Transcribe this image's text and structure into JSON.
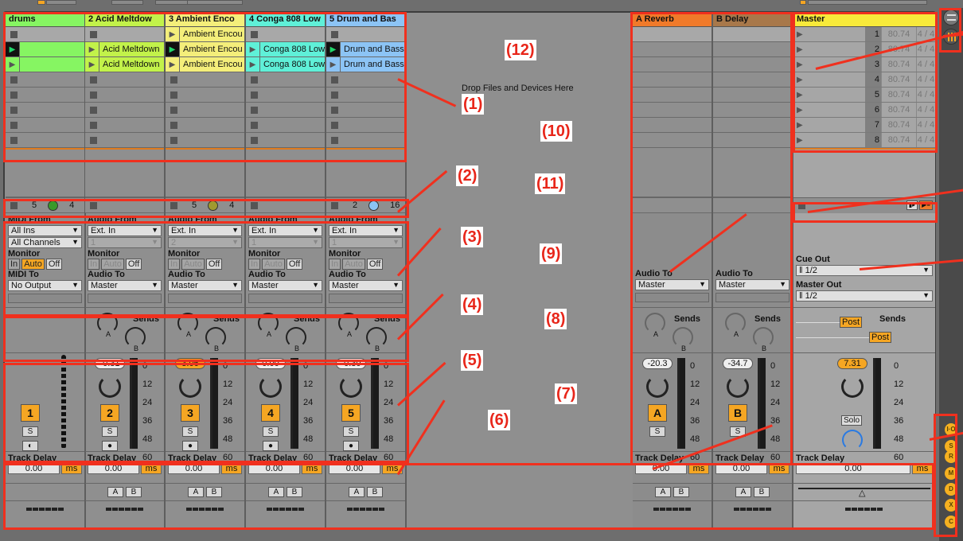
{
  "drop_hint": "Drop Files and Devices Here",
  "tracks": [
    {
      "name": "drums",
      "color": "#86f562",
      "clips": [
        null,
        {
          "name": "",
          "active": true
        },
        {
          "name": "",
          "active": false
        },
        null,
        null,
        null,
        null,
        null
      ],
      "first_slot_stop": true,
      "status": {
        "a": "5",
        "b": "4",
        "dot_color": "#3a9a2a"
      },
      "io": {
        "from_label": "MIDI From",
        "from": "All Ins",
        "channel": "All Channels",
        "channel_disabled": false,
        "to_label": "MIDI To",
        "to": "No Output",
        "monitor_state": "Auto"
      },
      "has_sends": false,
      "number": "1",
      "volume": null,
      "delay": "0.00",
      "has_ab": false
    },
    {
      "name": "2 Acid Meltdow",
      "color": "#c2f24a",
      "clips": [
        null,
        {
          "name": "Acid Meltdown",
          "active": false
        },
        {
          "name": "Acid Meltdown",
          "active": false
        },
        null,
        null,
        null,
        null,
        null
      ],
      "status": null,
      "io": {
        "from_label": "Audio From",
        "from": "Ext. In",
        "channel": "1",
        "channel_disabled": true,
        "to_label": "Audio To",
        "to": "Master",
        "monitor_state": "Off"
      },
      "has_sends": true,
      "number": "2",
      "volume": "-0.31",
      "volume_highlight": false,
      "delay": "0.00",
      "has_ab": true
    },
    {
      "name": "3 Ambient Enco",
      "color": "#f4ee7a",
      "clips": [
        {
          "name": "Ambient Encou",
          "active": false
        },
        {
          "name": "Ambient Encou",
          "active": true
        },
        {
          "name": "Ambient Encou",
          "active": false
        },
        null,
        null,
        null,
        null,
        null
      ],
      "status": {
        "a": "5",
        "b": "4",
        "dot_color": "#a09a30"
      },
      "io": {
        "from_label": "Audio From",
        "from": "Ext. In",
        "channel": "2",
        "channel_disabled": true,
        "to_label": "Audio To",
        "to": "Master",
        "monitor_state": "Off"
      },
      "has_sends": true,
      "number": "3",
      "volume": "3.06",
      "volume_highlight": true,
      "delay": "0.00",
      "has_ab": true
    },
    {
      "name": "4 Conga 808 Low",
      "color": "#5ff0d8",
      "clips": [
        null,
        {
          "name": "Conga 808 Low",
          "active": false
        },
        {
          "name": "Conga 808 Low",
          "active": false
        },
        null,
        null,
        null,
        null,
        null
      ],
      "status": null,
      "io": {
        "from_label": "Audio From",
        "from": "Ext. In",
        "channel": "1",
        "channel_disabled": true,
        "to_label": "Audio To",
        "to": "Master",
        "monitor_state": "Off"
      },
      "has_sends": true,
      "number": "4",
      "volume": "0.00",
      "volume_highlight": false,
      "delay": "0.00",
      "has_ab": true
    },
    {
      "name": "5 Drum and Bas",
      "color": "#8cc4f5",
      "clips": [
        null,
        {
          "name": "Drum and Bass",
          "active": true
        },
        {
          "name": "Drum and Bass",
          "active": false
        },
        null,
        null,
        null,
        null,
        null
      ],
      "status": {
        "a": "2",
        "b": "16",
        "dot_color": "#8cc4f5"
      },
      "io": {
        "from_label": "Audio From",
        "from": "Ext. In",
        "channel": "1",
        "channel_disabled": true,
        "to_label": "Audio To",
        "to": "Master",
        "monitor_state": "Off"
      },
      "has_sends": true,
      "number": "5",
      "volume": "-0.30",
      "volume_highlight": false,
      "delay": "0.00",
      "has_ab": true
    }
  ],
  "returns": [
    {
      "name": "A Reverb",
      "color": "#f07a2a",
      "audio_to_label": "Audio To",
      "audio_to": "Master",
      "volume": "-20.3",
      "letter": "A",
      "delay": "0.00"
    },
    {
      "name": "B Delay",
      "color": "#a8784a",
      "audio_to_label": "Audio To",
      "audio_to": "Master",
      "volume": "-34.7",
      "letter": "B",
      "delay": "0.00"
    }
  ],
  "master": {
    "name": "Master",
    "color": "#f8ea3a",
    "scenes": [
      {
        "num": "1",
        "tempo": "80.74",
        "sig": "4 / 4"
      },
      {
        "num": "2",
        "tempo": "80.74",
        "sig": "4 / 4"
      },
      {
        "num": "3",
        "tempo": "80.74",
        "sig": "4 / 4"
      },
      {
        "num": "4",
        "tempo": "80.74",
        "sig": "4 / 4"
      },
      {
        "num": "5",
        "tempo": "80.74",
        "sig": "4 / 4"
      },
      {
        "num": "6",
        "tempo": "80.74",
        "sig": "4 / 4"
      },
      {
        "num": "7",
        "tempo": "80.74",
        "sig": "4 / 4"
      },
      {
        "num": "8",
        "tempo": "80.74",
        "sig": "4 / 4"
      }
    ],
    "cue_out_label": "Cue Out",
    "cue_out": "1/2",
    "master_out_label": "Master Out",
    "master_out": "1/2",
    "post_label": "Post",
    "volume": "7.31",
    "solo_label": "Solo",
    "delay": "0.00"
  },
  "labels": {
    "sends": "Sends",
    "monitor": "Monitor",
    "monitor_in": "In",
    "monitor_auto": "Auto",
    "monitor_off": "Off",
    "track_delay": "Track Delay",
    "ms": "ms",
    "solo_short": "S",
    "send_a": "A",
    "send_b": "B"
  },
  "meter_scale": [
    "0",
    "12",
    "24",
    "36",
    "48",
    "60"
  ],
  "side_buttons": [
    "I·O",
    "S",
    "R",
    "M",
    "D",
    "X",
    "C"
  ],
  "annotations": [
    "(1)",
    "(2)",
    "(3)",
    "(4)",
    "(5)",
    "(6)",
    "(7)",
    "(8)",
    "(9)",
    "(10)",
    "(11)",
    "(12)"
  ]
}
